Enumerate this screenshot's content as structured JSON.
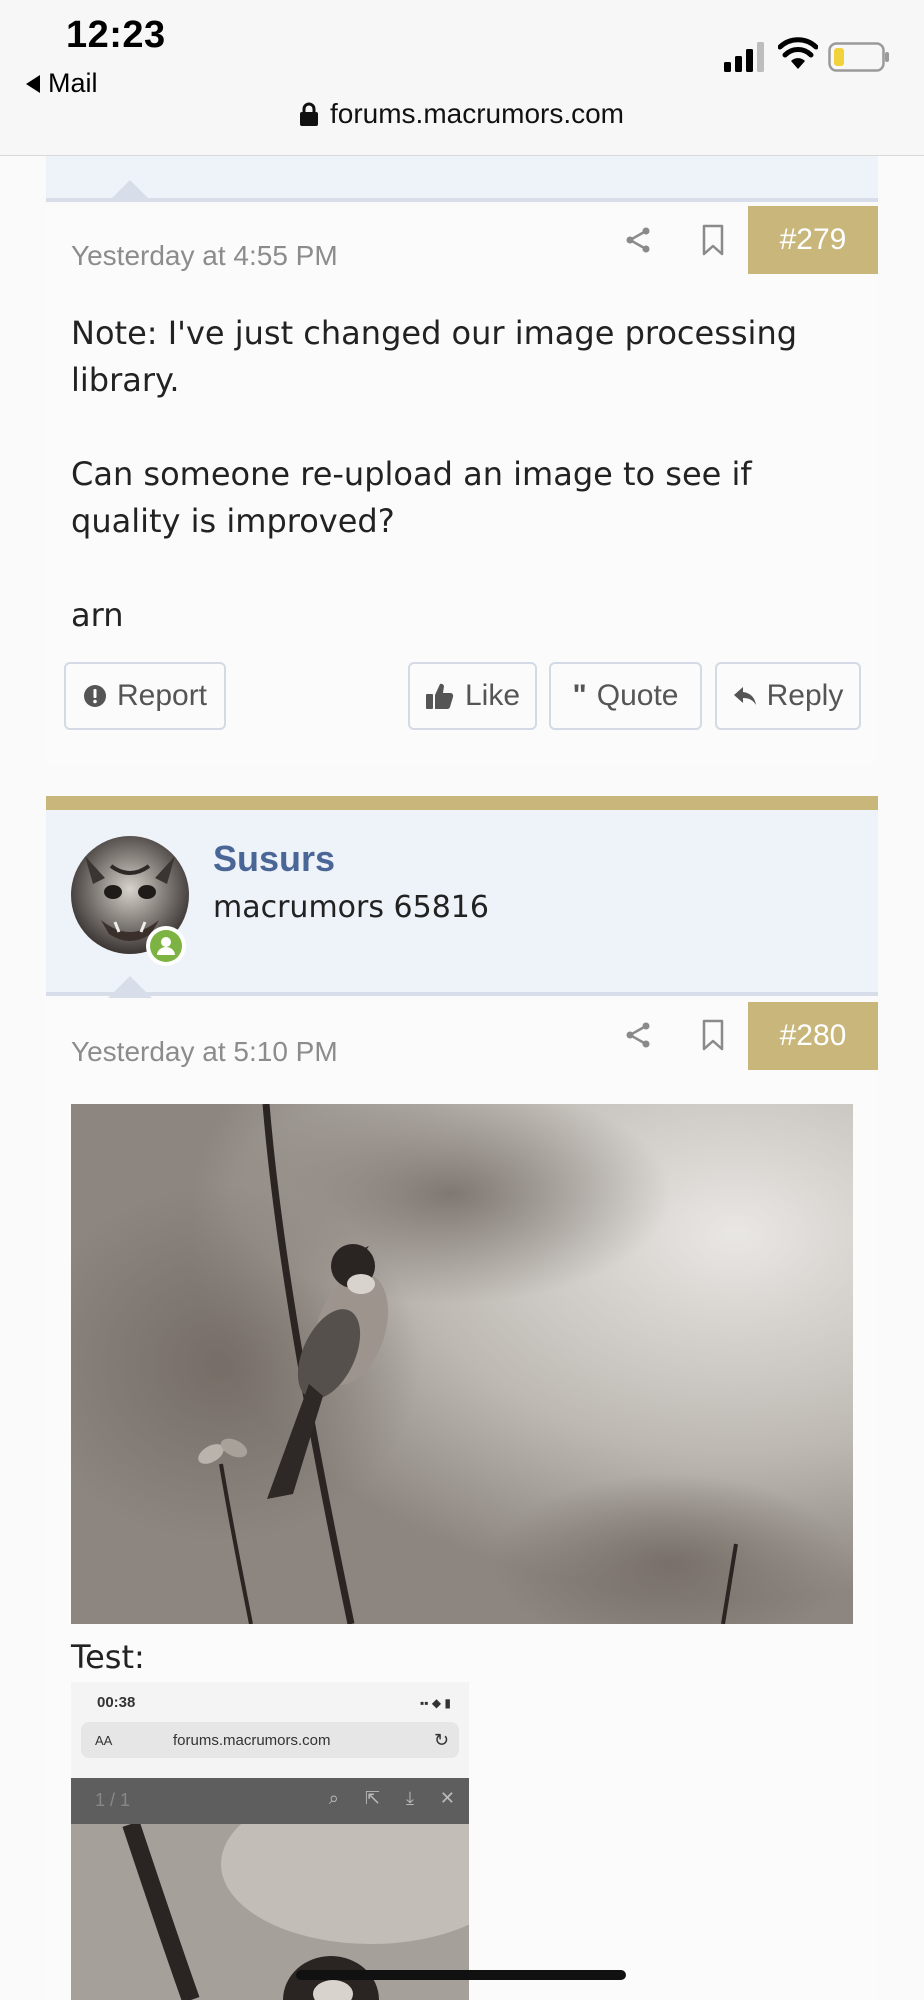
{
  "status_bar": {
    "time": "12:23",
    "back_app": "Mail",
    "url": "forums.macrumors.com"
  },
  "posts": [
    {
      "timestamp": "Yesterday at 4:55 PM",
      "number": "#279",
      "message": [
        "Note: I've just changed our image processing library.",
        "Can someone re-upload an image to see if quality is improved?",
        "arn"
      ],
      "actions": {
        "report": "Report",
        "like": "Like",
        "quote": "Quote",
        "reply": "Reply"
      }
    },
    {
      "author": "Susurs",
      "author_title": "macrumors 65816",
      "timestamp": "Yesterday at 5:10 PM",
      "number": "#280",
      "caption": "Test:",
      "embedded_screenshot": {
        "time": "00:38",
        "aa": "AA",
        "url": "forums.macrumors.com",
        "counter": "1 / 1"
      }
    }
  ],
  "colors": {
    "accent_gold": "#c8b67b",
    "header_blue": "#eef2f9",
    "username_blue": "#4a6696",
    "online_green": "#7cb342"
  }
}
